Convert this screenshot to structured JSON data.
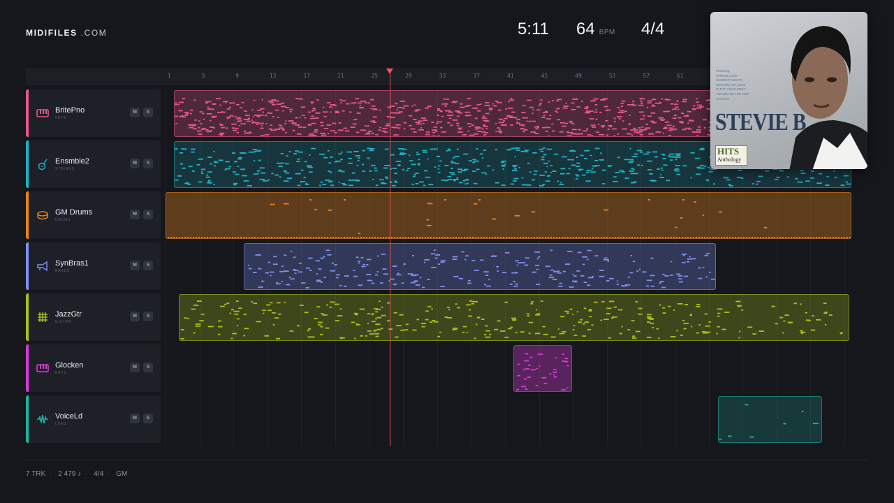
{
  "brand": {
    "name": "MIDIFILES",
    "suffix": ".COM"
  },
  "transport": {
    "time": "5:11",
    "bpm": "64",
    "bpm_unit": "BPM",
    "signature": "4/4"
  },
  "ruler": {
    "ticks": [
      "1",
      "5",
      "9",
      "13",
      "17",
      "21",
      "25",
      "29",
      "33",
      "37",
      "41",
      "45",
      "49",
      "53",
      "57",
      "61"
    ]
  },
  "tracks": [
    {
      "name": "BritePno",
      "type": "KEYS",
      "color": "#e8568c",
      "icon": "piano-icon",
      "mute": "M",
      "solo": "S"
    },
    {
      "name": "Ensmble2",
      "type": "STRINGS",
      "color": "#22b1c4",
      "icon": "guitar-icon",
      "mute": "M",
      "solo": "S"
    },
    {
      "name": "GM Drums",
      "type": "DRUMS",
      "color": "#e8841e",
      "icon": "drum-icon",
      "mute": "M",
      "solo": "S"
    },
    {
      "name": "SynBras1",
      "type": "BRASS",
      "color": "#7f8ff0",
      "icon": "trumpet-icon",
      "mute": "M",
      "solo": "S"
    },
    {
      "name": "JazzGtr",
      "type": "GUITAR",
      "color": "#a9c21c",
      "icon": "grid-icon",
      "mute": "M",
      "solo": "S"
    },
    {
      "name": "Glocken",
      "type": "KEYS",
      "color": "#d93ad6",
      "icon": "piano-icon",
      "mute": "M",
      "solo": "S"
    },
    {
      "name": "VoiceLd",
      "type": "LEAD",
      "color": "#1fb5a2",
      "icon": "waveform-icon",
      "mute": "M",
      "solo": "S"
    }
  ],
  "footer": {
    "tracks": "7 TRK",
    "notes": "2 479 ♪",
    "signature": "4/4",
    "standard": "GM"
  },
  "album": {
    "featuring": [
      "Featuring:",
      "SPRING LOVE",
      "SUMMER NIGHTS",
      "DREAMIN' OF LOVE",
      "PARTY YOUR BODY",
      "I WANNA BE THE ONE",
      "and more"
    ],
    "artist": "STEVIE B",
    "badge_title": "HITS",
    "badge_sub": "Anthology"
  }
}
